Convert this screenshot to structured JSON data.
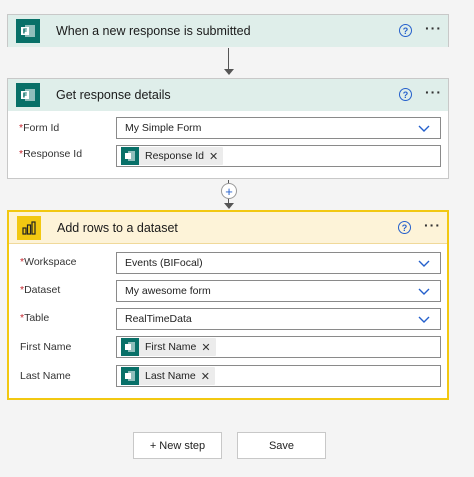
{
  "trigger": {
    "title": "When a new response is submitted"
  },
  "get_details": {
    "title": "Get response details",
    "fields": [
      {
        "label": "Form Id",
        "required": "*",
        "value": "My Simple Form"
      },
      {
        "label": "Response Id",
        "required": "*",
        "token": "Response Id"
      }
    ]
  },
  "add_rows": {
    "title": "Add rows to a dataset",
    "fields": [
      {
        "label": "Workspace",
        "required": "*",
        "value": "Events (BIFocal)"
      },
      {
        "label": "Dataset",
        "required": "*",
        "value": "My awesome form"
      },
      {
        "label": "Table",
        "required": "*",
        "value": "RealTimeData"
      },
      {
        "label": "First Name",
        "token": "First Name"
      },
      {
        "label": "Last Name",
        "token": "Last Name"
      }
    ]
  },
  "icons": {
    "help": "?",
    "more": "···",
    "remove": "✕",
    "plus": "+"
  },
  "buttons": {
    "new_step": "+ New step",
    "save": "Save"
  },
  "colors": {
    "forms": "#087068",
    "powerbi": "#f2c811",
    "accent": "#2560cc",
    "required": "#c4262e"
  }
}
